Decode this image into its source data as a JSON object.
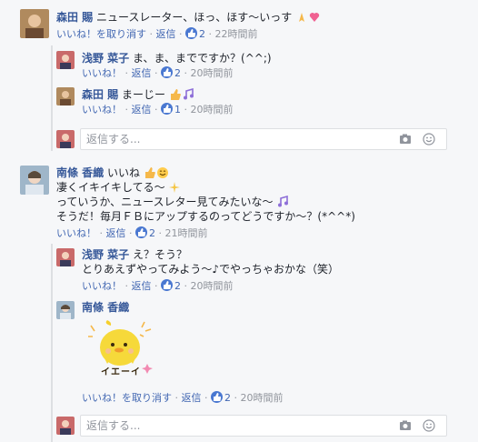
{
  "comments": [
    {
      "name": "森田 賜",
      "text": "ニュースレーター、ほっ、ほす〜いっす",
      "emoji": [
        "praying-hands-icon",
        "heart-icon"
      ],
      "actions": {
        "like": "いいね！を取り消す",
        "reply": "返信",
        "count": "2",
        "time": "22時間前"
      }
    },
    {
      "name": "浅野 菜子",
      "text": "ま、ま、までですか？(^^;)",
      "actions": {
        "like": "いいね！",
        "reply": "返信",
        "count": "2",
        "time": "20時間前"
      }
    },
    {
      "name": "森田 賜",
      "text": "まーじー",
      "emoji": [
        "thumbs-up-icon",
        "music-note-icon"
      ],
      "actions": {
        "like": "いいね！",
        "reply": "返信",
        "count": "1",
        "time": "20時間前"
      }
    },
    {
      "name": "南條 香織",
      "line1": "いいね",
      "line2": "凄くイキイキしてる〜",
      "line3": "っていうか、ニュースレター見てみたいな〜",
      "line4": "そうだ！毎月ＦＢにアップするのってどうですか〜？(*^^*)",
      "actions": {
        "like": "いいね！",
        "reply": "返信",
        "count": "2",
        "time": "21時間前"
      }
    },
    {
      "name": "浅野 菜子",
      "line1": "え？そう？",
      "line2": "とりあえずやってみよう〜♪でやっちゃおかな（笑）",
      "actions": {
        "like": "いいね！",
        "reply": "返信",
        "count": "2",
        "time": "20時間前"
      }
    },
    {
      "name": "南條 香織",
      "sticker_text": "イエーイ",
      "actions": {
        "like": "いいね！を取り消す",
        "reply": "返信",
        "count": "2",
        "time": "20時間前"
      }
    }
  ],
  "reply_box": {
    "placeholder": "返信する..."
  },
  "separator": "·"
}
